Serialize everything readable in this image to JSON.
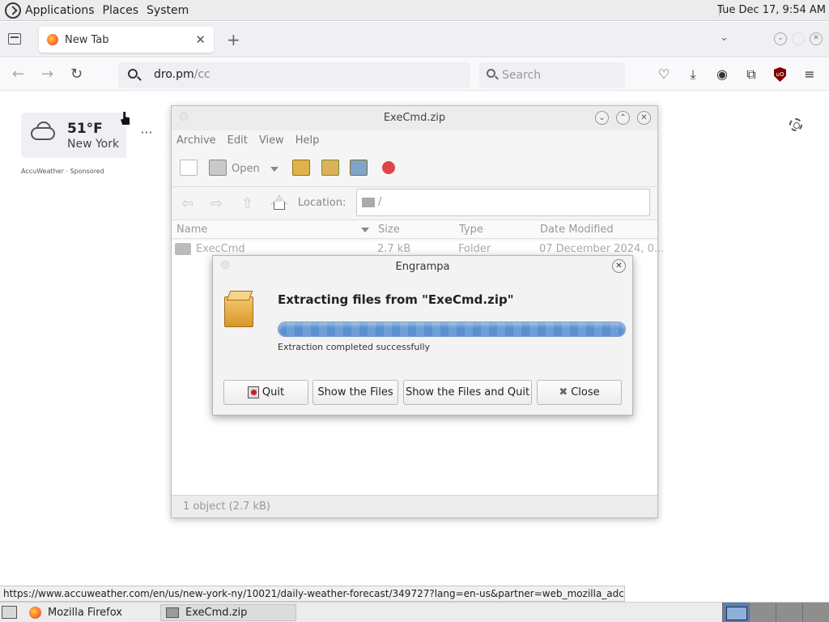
{
  "top_panel": {
    "menus": [
      "Applications",
      "Places",
      "System"
    ],
    "clock": "Tue Dec 17,  9:54 AM"
  },
  "browser": {
    "tab_title": "New Tab",
    "url_host": "dro.pm",
    "url_path": "/cc",
    "search_placeholder": "Search",
    "link_status": "https://www.accuweather.com/en/us/new-york-ny/10021/daily-weather-forecast/349727?lang=en-us&partner=web_mozilla_adc"
  },
  "weather": {
    "temperature": "51°F",
    "city": "New York",
    "sponsor": "AccuWeather · Sponsored",
    "more": "···"
  },
  "archive_window": {
    "title": "ExeCmd.zip",
    "menu": [
      "Archive",
      "Edit",
      "View",
      "Help"
    ],
    "open_label": "Open",
    "location_label": "Location:",
    "location_path": "/",
    "columns": [
      "Name",
      "Size",
      "Type",
      "Date Modified"
    ],
    "rows": [
      {
        "name": "ExecCmd",
        "size": "2.7 kB",
        "type": "Folder",
        "date": "07 December 2024, 0..."
      }
    ],
    "status": "1 object (2.7 kB)"
  },
  "extract_dialog": {
    "title": "Engrampa",
    "heading": "Extracting files from \"ExeCmd.zip\"",
    "progress_percent": 100,
    "message": "Extraction completed successfully",
    "buttons": {
      "quit": "Quit",
      "show_files": "Show the Files",
      "show_files_quit": "Show the Files and Quit",
      "close": "Close"
    }
  },
  "taskbar": {
    "tasks": [
      "Mozilla Firefox",
      "ExeCmd.zip"
    ]
  }
}
